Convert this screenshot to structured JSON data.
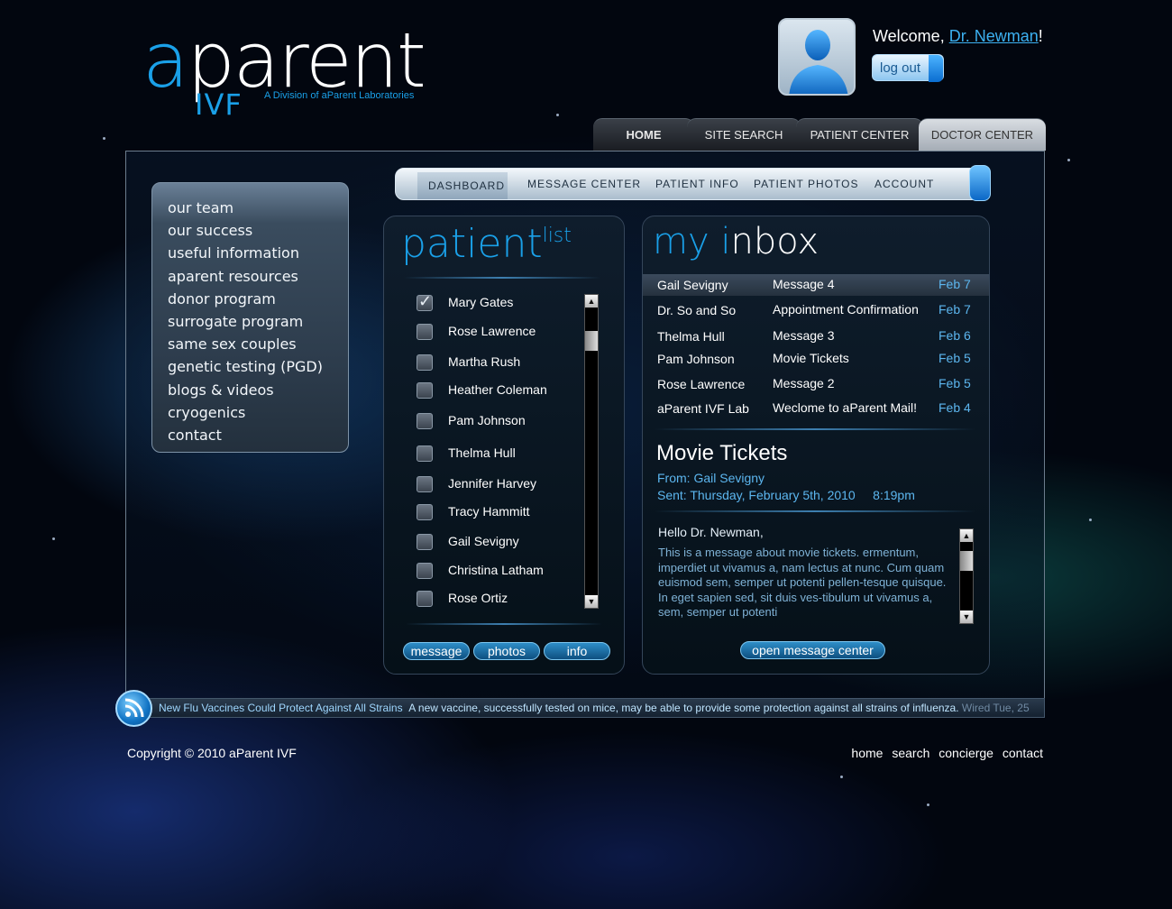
{
  "logo": {
    "wordmark_a": "a",
    "wordmark_rest": "parent",
    "ivf": "IVF",
    "tagline": "A Division of aParent Laboratories"
  },
  "user": {
    "welcome_prefix": "Welcome, ",
    "name": "Dr. Newman",
    "welcome_suffix": "!",
    "logout_label": "log out"
  },
  "top_tabs": [
    {
      "label": "HOME"
    },
    {
      "label": "SITE SEARCH"
    },
    {
      "label": "PATIENT CENTER"
    },
    {
      "label": "DOCTOR CENTER"
    }
  ],
  "sub_tabs": [
    {
      "label": "DASHBOARD"
    },
    {
      "label": "MESSAGE CENTER"
    },
    {
      "label": "PATIENT INFO"
    },
    {
      "label": "PATIENT PHOTOS"
    },
    {
      "label": "ACCOUNT"
    }
  ],
  "sidenav": [
    "our team",
    "our success",
    "useful information",
    "aparent resources",
    "donor program",
    "surrogate program",
    "same sex couples",
    "genetic testing (PGD)",
    "blogs & videos",
    "cryogenics",
    "contact"
  ],
  "patient_list": {
    "title_main": "patient",
    "title_sup": "list",
    "patients": [
      {
        "name": "Mary Gates",
        "checked": true
      },
      {
        "name": "Rose Lawrence",
        "checked": false
      },
      {
        "name": "Martha Rush",
        "checked": false
      },
      {
        "name": "Heather Coleman",
        "checked": false
      },
      {
        "name": "Pam Johnson",
        "checked": false
      },
      {
        "name": "Thelma Hull",
        "checked": false
      },
      {
        "name": "Jennifer Harvey",
        "checked": false
      },
      {
        "name": "Tracy Hammitt",
        "checked": false
      },
      {
        "name": "Gail Sevigny",
        "checked": false
      },
      {
        "name": "Christina Latham",
        "checked": false
      },
      {
        "name": "Rose Ortiz",
        "checked": false
      }
    ],
    "buttons": {
      "message": "message",
      "photos": "photos",
      "info": "info"
    }
  },
  "inbox": {
    "title_my": "my ",
    "title_i": "i",
    "title_nbox": "nbox",
    "messages": [
      {
        "from": "Gail Sevigny",
        "subject": "Message 4",
        "date": "Feb 7",
        "selected": true
      },
      {
        "from": "Dr. So and So",
        "subject": "Appointment Confirmation",
        "date": "Feb 7",
        "selected": false
      },
      {
        "from": "Thelma Hull",
        "subject": "Message 3",
        "date": "Feb 6",
        "selected": false
      },
      {
        "from": "Pam Johnson",
        "subject": "Movie Tickets",
        "date": "Feb 5",
        "selected": false
      },
      {
        "from": "Rose Lawrence",
        "subject": "Message 2",
        "date": "Feb 5",
        "selected": false
      },
      {
        "from": "aParent IVF Lab",
        "subject": "Weclome to aParent Mail!",
        "date": "Feb 4",
        "selected": false
      }
    ],
    "preview": {
      "title": "Movie Tickets",
      "from": "From: Gail Sevigny",
      "sent": "Sent: Thursday, February 5th, 2010     8:19pm",
      "greeting": "Hello Dr. Newman,",
      "body": "This is a message about movie tickets. ermentum, imperdiet ut vivamus a, nam lectus at nunc. Cum quam euismod sem, semper ut potenti pellen-tesque quisque. In eget sapien sed, sit duis ves-tibulum ut vivamus a, sem, semper ut potenti"
    },
    "open_button": "open message center"
  },
  "ticker": {
    "headline": "New Flu Vaccines Could Protect Against All Strains",
    "body": "A new vaccine, successfully tested on mice, may be able to provide some protection against all strains of influenza.",
    "source": "Wired Tue, 25"
  },
  "footer": {
    "copyright": "Copyright © 2010 aParent IVF",
    "links": [
      "home",
      "search",
      "concierge",
      "contact"
    ]
  },
  "colors": {
    "accent_blue": "#1aa0e8",
    "link_blue": "#5cb6ef",
    "background": "#02060f"
  }
}
